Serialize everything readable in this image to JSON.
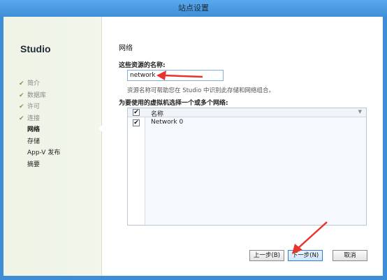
{
  "window": {
    "title": "站点设置"
  },
  "sidebar": {
    "brand": "Studio",
    "steps": [
      {
        "label": "简介",
        "state": "done"
      },
      {
        "label": "数据库",
        "state": "done"
      },
      {
        "label": "许可",
        "state": "done"
      },
      {
        "label": "连接",
        "state": "done"
      },
      {
        "label": "网络",
        "state": "current"
      },
      {
        "label": "存储",
        "state": "future"
      },
      {
        "label": "App-V 发布",
        "state": "future"
      },
      {
        "label": "摘要",
        "state": "future"
      }
    ]
  },
  "main": {
    "heading": "网络",
    "name_label": "这些资源的名称:",
    "name_value": "network",
    "name_hint": "资源名称可帮助您在 Studio 中识别此存储和网络组合。",
    "network_label": "为要使用的虚拟机选择一个或多个网络:",
    "grid": {
      "column_name": "名称",
      "rows": [
        {
          "name": "Network 0",
          "checked": true
        }
      ]
    }
  },
  "buttons": {
    "back": "上一步(B)",
    "next": "下一步(N)",
    "cancel": "取消"
  },
  "colors": {
    "accent": "#3e8ed8",
    "annotation_arrow": "#e8342c"
  }
}
